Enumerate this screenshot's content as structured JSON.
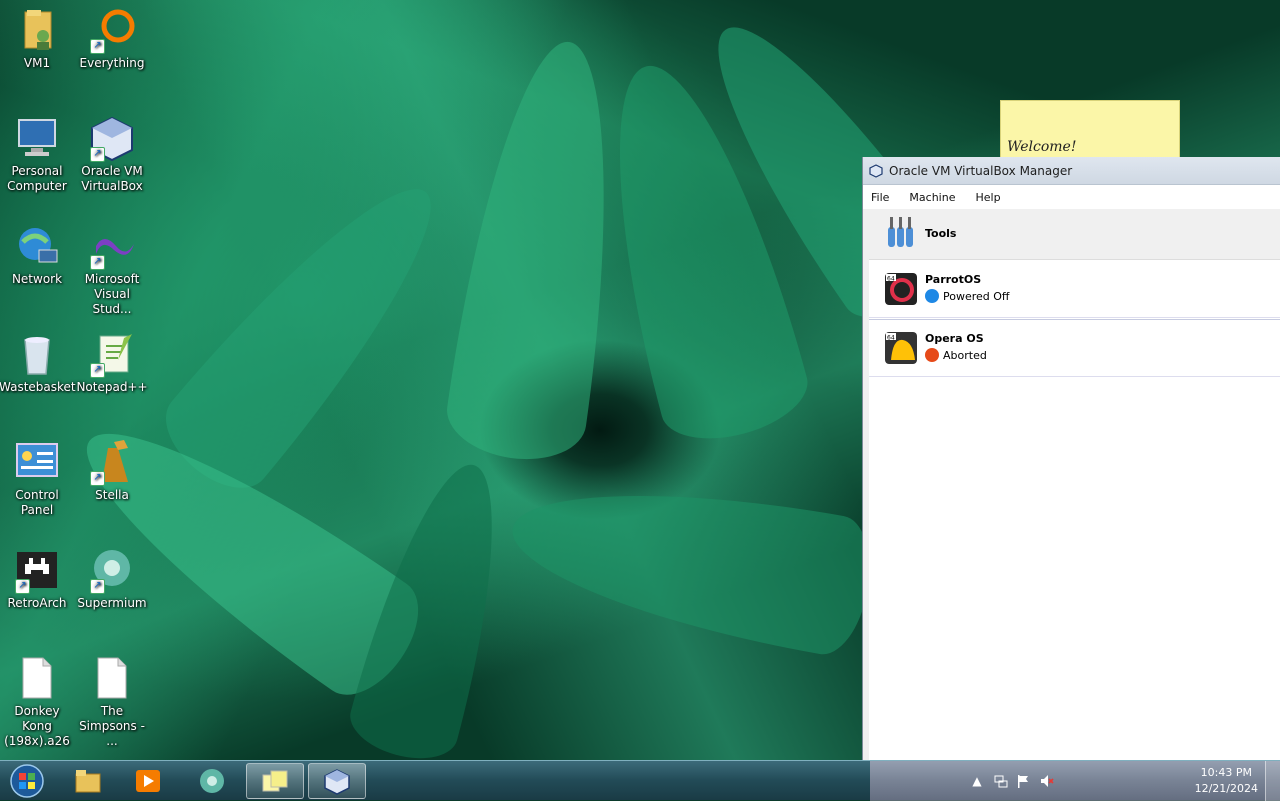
{
  "desktop": {
    "icons": [
      {
        "label": "VM1"
      },
      {
        "label": "Everything"
      },
      {
        "label": "Personal Computer"
      },
      {
        "label": "Oracle VM VirtualBox"
      },
      {
        "label": "Network"
      },
      {
        "label": "Microsoft Visual Stud..."
      },
      {
        "label": "Wastebasket"
      },
      {
        "label": "Notepad++"
      },
      {
        "label": "Control Panel"
      },
      {
        "label": "Stella"
      },
      {
        "label": "RetroArch"
      },
      {
        "label": "Supermium"
      },
      {
        "label": "Donkey Kong (198x).a26"
      },
      {
        "label": "The Simpsons - ..."
      }
    ]
  },
  "sticky_note": {
    "text": "Welcome!"
  },
  "vbox": {
    "title": "Oracle VM VirtualBox Manager",
    "menu": {
      "file": "File",
      "machine": "Machine",
      "help": "Help"
    },
    "tools_label": "Tools",
    "vms": [
      {
        "name": "ParrotOS",
        "state": "Powered Off",
        "state_color": "#1e88e5"
      },
      {
        "name": "Opera OS",
        "state": "Aborted",
        "state_color": "#e64a19"
      }
    ]
  },
  "taskbar": {
    "clock": {
      "time": "10:43 PM",
      "date": "12/21/2024"
    }
  }
}
